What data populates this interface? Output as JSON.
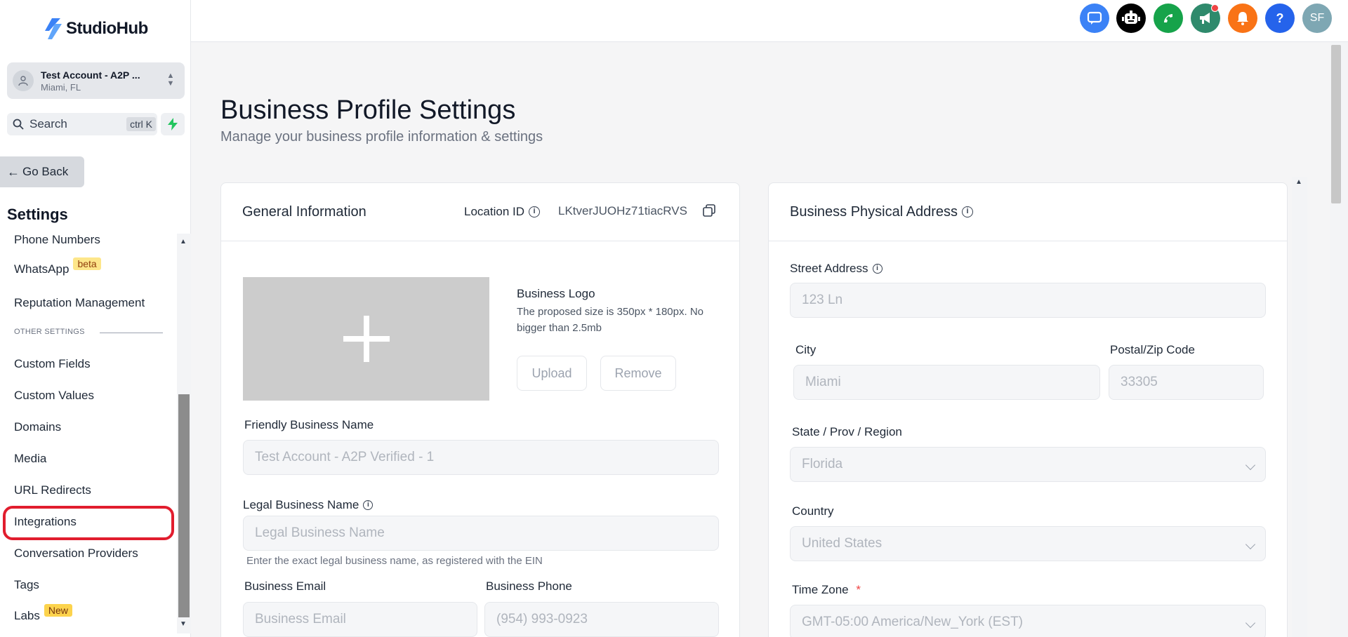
{
  "brand": {
    "name": "StudioHub"
  },
  "account": {
    "name": "Test Account - A2P ...",
    "location": "Miami, FL"
  },
  "search": {
    "label": "Search",
    "shortcut": "ctrl K"
  },
  "sidebar": {
    "go_back": "Go Back",
    "title": "Settings",
    "items": [
      {
        "label": "Phone Numbers"
      },
      {
        "label": "WhatsApp",
        "badge": "beta"
      },
      {
        "label": "Reputation Management"
      },
      {
        "label": "Custom Fields"
      },
      {
        "label": "Custom Values"
      },
      {
        "label": "Domains"
      },
      {
        "label": "Media"
      },
      {
        "label": "URL Redirects"
      },
      {
        "label": "Integrations"
      },
      {
        "label": "Conversation Providers"
      },
      {
        "label": "Tags"
      },
      {
        "label": "Labs",
        "badge": "New"
      }
    ],
    "section_other": "OTHER SETTINGS"
  },
  "topbar": {
    "avatar_initials": "SF",
    "help_label": "?",
    "icons": [
      "chat-icon",
      "bot-icon",
      "phone-icon",
      "megaphone-icon",
      "bell-icon",
      "help-icon"
    ],
    "colors": {
      "chat": "#3b82f6",
      "bot": "#000000",
      "phone": "#16a34a",
      "megaphone": "#2f8a6c",
      "bell": "#f97316",
      "help": "#2563eb",
      "avatar": "#7ea7b3"
    }
  },
  "page": {
    "title": "Business Profile Settings",
    "subtitle": "Manage your business profile information & settings"
  },
  "general": {
    "title": "General Information",
    "location_id_label": "Location ID",
    "location_id": "LKtverJUOHz71tiacRVS",
    "logo_title": "Business Logo",
    "logo_hint": "The proposed size is 350px * 180px. No bigger than 2.5mb",
    "upload": "Upload",
    "remove": "Remove",
    "friendly_name_label": "Friendly Business Name",
    "friendly_name_value": "Test Account - A2P Verified - 1",
    "legal_name_label": "Legal Business Name",
    "legal_name_placeholder": "Legal Business Name",
    "legal_name_hint": "Enter the exact legal business name, as registered with the EIN",
    "email_label": "Business Email",
    "email_placeholder": "Business Email",
    "phone_label": "Business Phone",
    "phone_value": "(954) 993-0923"
  },
  "address": {
    "title": "Business Physical Address",
    "street_label": "Street Address",
    "street_value": "123 Ln",
    "city_label": "City",
    "city_value": "Miami",
    "zip_label": "Postal/Zip Code",
    "zip_value": "33305",
    "state_label": "State / Prov / Region",
    "state_value": "Florida",
    "country_label": "Country",
    "country_value": "United States",
    "tz_label": "Time Zone",
    "tz_required": "*",
    "tz_value": "GMT-05:00 America/New_York (EST)"
  }
}
